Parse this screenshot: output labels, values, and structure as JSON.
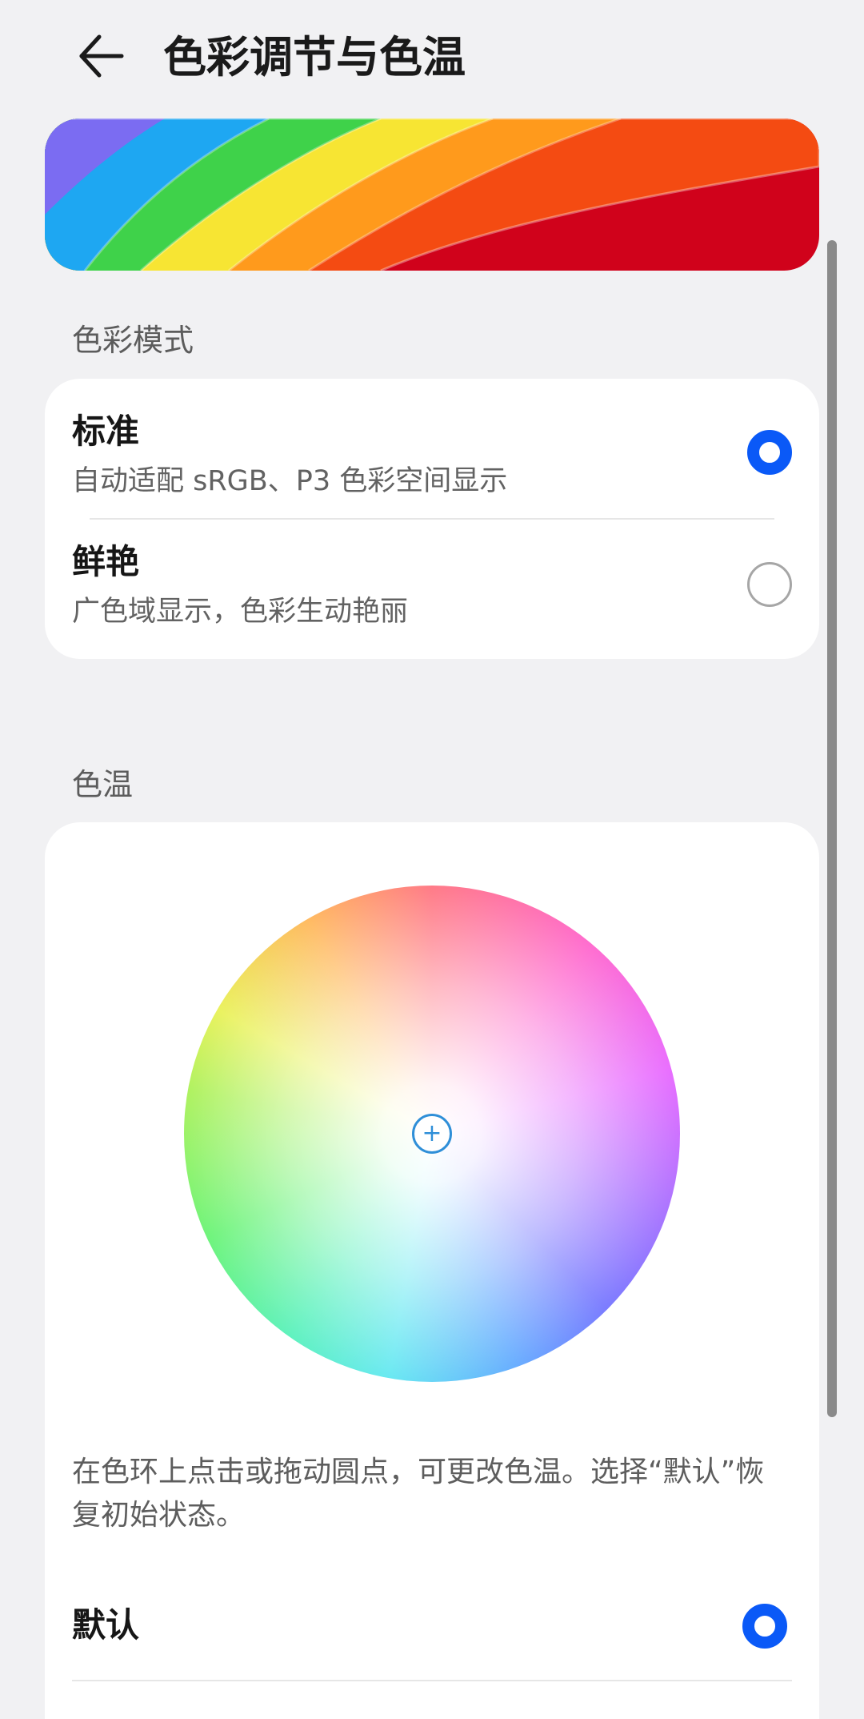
{
  "header": {
    "back_icon": "arrow-left-icon",
    "title": "色彩调节与色温"
  },
  "color_mode": {
    "section_label": "色彩模式",
    "options": [
      {
        "title": "标准",
        "subtitle": "自动适配 sRGB、P3 色彩空间显示",
        "selected": true
      },
      {
        "title": "鲜艳",
        "subtitle": "广色域显示，色彩生动艳丽",
        "selected": false
      }
    ]
  },
  "color_temp": {
    "section_label": "色温",
    "hint": "在色环上点击或拖动圆点，可更改色温。选择“默认”恢复初始状态。",
    "handle_icon": "plus-icon",
    "default_option": {
      "title": "默认",
      "selected": true
    }
  },
  "colors": {
    "accent": "#0a59f7",
    "background": "#f1f1f3",
    "card": "#ffffff"
  }
}
